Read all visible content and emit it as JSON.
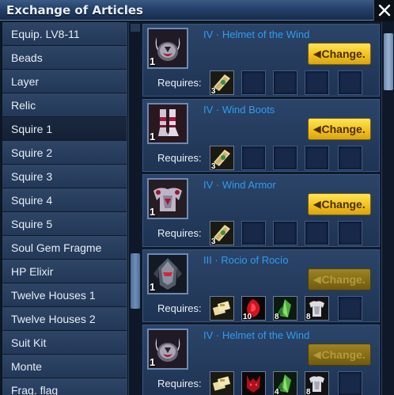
{
  "window": {
    "title": "Exchange of Articles"
  },
  "categories": [
    "Equip. LV8-11",
    "Beads",
    "Layer",
    "Relic",
    "Squire 1",
    "Squire 2",
    "Squire 3",
    "Squire 4",
    "Squire 5",
    "Soul Gem Fragme",
    "HP Elixir",
    "Twelve Houses 1",
    "Twelve Houses 2",
    "Suit Kit",
    "Monte",
    "Frag. flag"
  ],
  "selected_category": "Squire 1",
  "requires_label": "Requires:",
  "items": [
    {
      "name": "IV · Helmet of the Wind",
      "count": "1",
      "icon": "wind-helmet-icon",
      "button": "Change.",
      "enabled": true,
      "requirements": [
        {
          "icon": "scroll-icon",
          "count": "3"
        },
        {
          "icon": "empty-slot",
          "count": ""
        },
        {
          "icon": "empty-slot",
          "count": ""
        },
        {
          "icon": "empty-slot",
          "count": ""
        },
        {
          "icon": "empty-slot",
          "count": ""
        }
      ]
    },
    {
      "name": "IV · Wind Boots",
      "count": "1",
      "icon": "wind-boots-icon",
      "button": "Change.",
      "enabled": true,
      "requirements": [
        {
          "icon": "scroll-icon",
          "count": "3"
        },
        {
          "icon": "empty-slot",
          "count": ""
        },
        {
          "icon": "empty-slot",
          "count": ""
        },
        {
          "icon": "empty-slot",
          "count": ""
        },
        {
          "icon": "empty-slot",
          "count": ""
        }
      ]
    },
    {
      "name": "IV · Wind Armor",
      "count": "1",
      "icon": "wind-armor-icon",
      "button": "Change.",
      "enabled": true,
      "requirements": [
        {
          "icon": "scroll-icon",
          "count": "3"
        },
        {
          "icon": "empty-slot",
          "count": ""
        },
        {
          "icon": "empty-slot",
          "count": ""
        },
        {
          "icon": "empty-slot",
          "count": ""
        },
        {
          "icon": "empty-slot",
          "count": ""
        }
      ]
    },
    {
      "name": "III · Rocio of Rocío",
      "count": "1",
      "icon": "rocio-helmet-icon",
      "button": "Change.",
      "enabled": false,
      "requirements": [
        {
          "icon": "gold-bundle-icon",
          "count": ""
        },
        {
          "icon": "red-gem-icon",
          "count": "10"
        },
        {
          "icon": "green-crystal-icon",
          "count": "8"
        },
        {
          "icon": "silver-armor-icon",
          "count": "8"
        },
        {
          "icon": "empty-slot",
          "count": ""
        }
      ]
    },
    {
      "name": "IV · Helmet of the Wind",
      "count": "1",
      "icon": "wind-helmet-icon",
      "button": "Change.",
      "enabled": false,
      "requirements": [
        {
          "icon": "gold-bundle-icon",
          "count": ""
        },
        {
          "icon": "red-demon-icon",
          "count": ""
        },
        {
          "icon": "green-crystal-icon",
          "count": "4"
        },
        {
          "icon": "silver-armor-icon",
          "count": "8"
        },
        {
          "icon": "empty-slot",
          "count": ""
        }
      ]
    }
  ]
}
